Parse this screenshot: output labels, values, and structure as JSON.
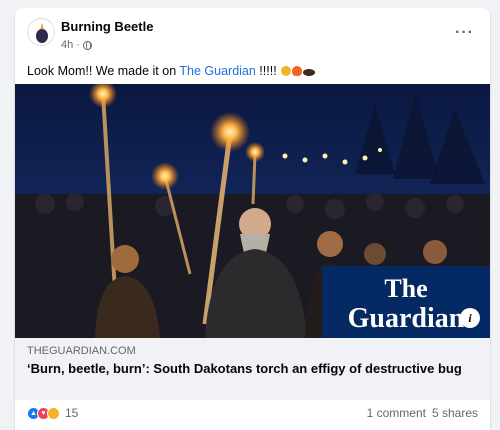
{
  "post": {
    "author": "Burning Beetle",
    "time": "4h",
    "separator": "·",
    "more_label": "···",
    "text_before": "Look Mom!! We made it on ",
    "text_link": "The Guardian",
    "text_after": " !!!!! "
  },
  "media": {
    "logo_line1": "The",
    "logo_line2": "Guardian",
    "info_label": "i"
  },
  "link_preview": {
    "domain": "THEGUARDIAN.COM",
    "headline": "‘Burn, beetle, burn’: South Dakotans torch an effigy of destructive bug"
  },
  "engagement": {
    "reaction_count": "15",
    "comments": "1 comment",
    "shares": "5 shares"
  },
  "colors": {
    "link": "#216fdb",
    "guardian_blue": "#052962",
    "like": "#1877f2",
    "love": "#f33e58",
    "haha": "#f7b125"
  }
}
